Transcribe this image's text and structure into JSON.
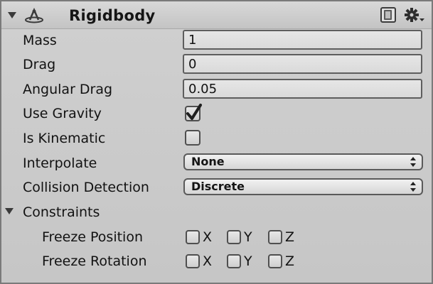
{
  "component": {
    "title": "Rigidbody",
    "expanded": true,
    "icons": {
      "component_icon": "rigidbody-icon",
      "help": "help-book-icon",
      "settings": "gear-icon"
    }
  },
  "properties": {
    "mass": {
      "label": "Mass",
      "value": "1"
    },
    "drag": {
      "label": "Drag",
      "value": "0"
    },
    "angular_drag": {
      "label": "Angular Drag",
      "value": "0.05"
    },
    "use_gravity": {
      "label": "Use Gravity",
      "checked": true
    },
    "is_kinematic": {
      "label": "Is Kinematic",
      "checked": false
    },
    "interpolate": {
      "label": "Interpolate",
      "value": "None"
    },
    "collision_detection": {
      "label": "Collision Detection",
      "value": "Discrete"
    }
  },
  "constraints": {
    "label": "Constraints",
    "expanded": true,
    "freeze_position": {
      "label": "Freeze Position",
      "axes": [
        {
          "label": "X",
          "checked": false
        },
        {
          "label": "Y",
          "checked": false
        },
        {
          "label": "Z",
          "checked": false
        }
      ]
    },
    "freeze_rotation": {
      "label": "Freeze Rotation",
      "axes": [
        {
          "label": "X",
          "checked": false
        },
        {
          "label": "Y",
          "checked": false
        },
        {
          "label": "Z",
          "checked": false
        }
      ]
    }
  },
  "colors": {
    "panel_background": "#c9c9c9",
    "field_background": "#e0e0e0",
    "field_border": "#5e5e5e",
    "text": "#121212"
  }
}
